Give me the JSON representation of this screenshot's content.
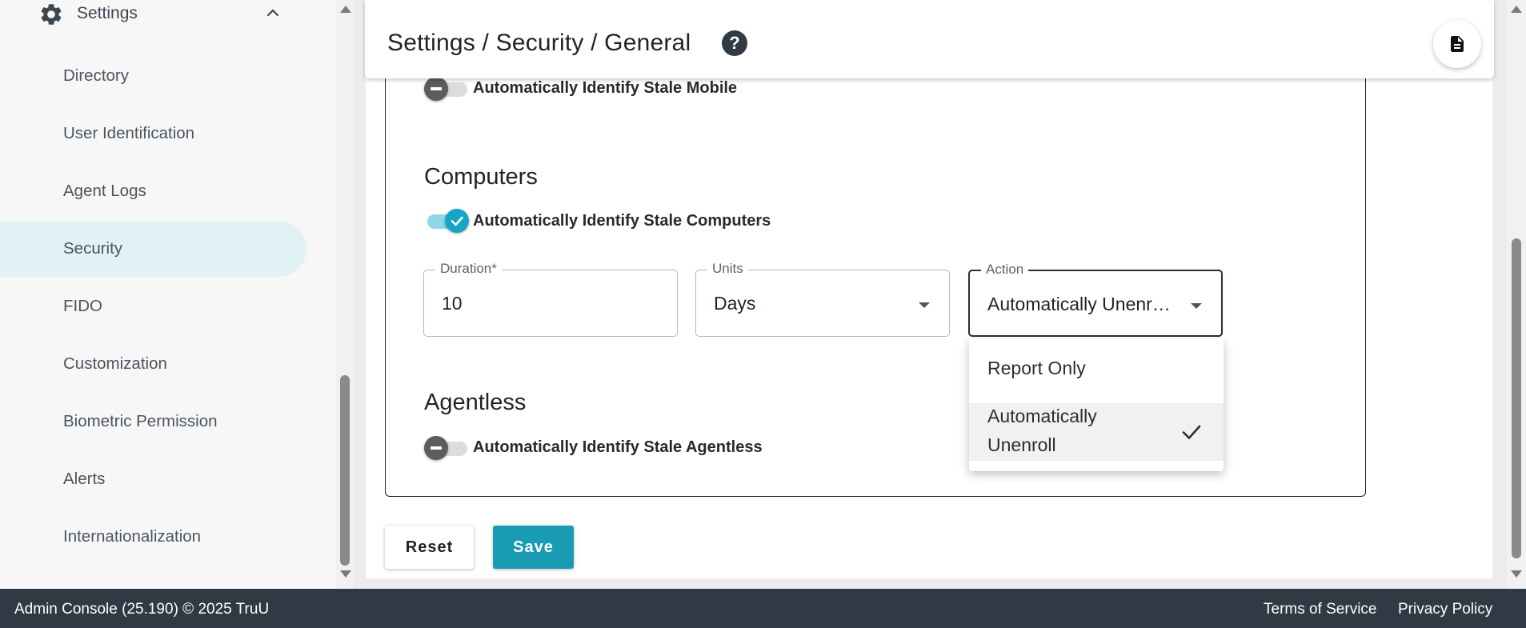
{
  "sidebar": {
    "parent": {
      "label": "Settings",
      "icon": "gear-icon",
      "chevron": "chevron-up-icon"
    },
    "items": [
      {
        "label": "Directory"
      },
      {
        "label": "User Identification"
      },
      {
        "label": "Agent Logs"
      },
      {
        "label": "Security",
        "active": true
      },
      {
        "label": "FIDO"
      },
      {
        "label": "Customization"
      },
      {
        "label": "Biometric Permission"
      },
      {
        "label": "Alerts"
      },
      {
        "label": "Internationalization"
      }
    ]
  },
  "header": {
    "title": "Settings / Security / General",
    "help_icon": "help-circle-icon",
    "help_glyph": "?",
    "doc_icon": "document-icon"
  },
  "mobile": {
    "toggle_label": "Automatically Identify Stale Mobile",
    "enabled": false
  },
  "computers": {
    "title": "Computers",
    "toggle_label": "Automatically Identify Stale Computers",
    "enabled": true,
    "duration": {
      "label": "Duration*",
      "value": "10"
    },
    "units": {
      "label": "Units",
      "value": "Days"
    },
    "action": {
      "label": "Action",
      "value": "Automatically Unenr…"
    }
  },
  "action_menu": {
    "options": [
      {
        "label": "Report Only",
        "selected": false
      },
      {
        "label": "Automatically Unenroll",
        "line1": "Automatically",
        "line2": "Unenroll",
        "selected": true
      }
    ]
  },
  "agentless": {
    "title": "Agentless",
    "toggle_label": "Automatically Identify Stale Agentless",
    "enabled": false
  },
  "buttons": {
    "reset": "Reset",
    "save": "Save"
  },
  "footer": {
    "copyright": "Admin Console (25.190) © 2025 TruU",
    "terms": "Terms of Service",
    "privacy": "Privacy Policy"
  },
  "colors": {
    "accent": "#1a9bb4",
    "footer_bg": "#2f3a44",
    "active_nav_bg": "#e1f1f4"
  }
}
